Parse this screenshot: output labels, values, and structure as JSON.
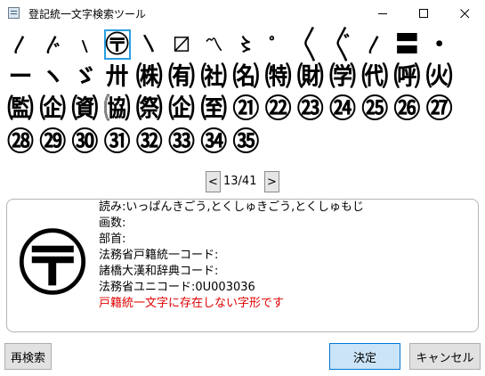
{
  "window": {
    "title": "登記統一文字検索ツール",
    "minimize_icon": "minimize-icon",
    "maximize_icon": "maximize-icon",
    "close_icon": "close-icon"
  },
  "glyph_grid": {
    "selected_color": "#2b9fe0",
    "rows": [
      [
        "〳",
        "〴",
        "﹨",
        "〶",
        "〵",
        "〼",
        "〽",
        "〻",
        "゜",
        "〱",
        "〲",
        "〳",
        "〓",
        "・"
      ],
      [
        "ー",
        "ヽ",
        "ゞ",
        "〺",
        "㈱",
        "㈲",
        "㈳",
        "㈴",
        "㈵",
        "㈶",
        "㈻",
        "㈹",
        "㈺",
        "㈫"
      ],
      [
        "㈼",
        "㈽",
        "㈾",
        "㈿",
        "㉀",
        "㈽",
        "㉃",
        "㉑",
        "㉒",
        "㉓",
        "㉔",
        "㉕",
        "㉖",
        "㉗"
      ],
      [
        "㉘",
        "㉙",
        "㉚",
        "㉛",
        "㉜",
        "㉝",
        "㉞",
        "㉟"
      ]
    ],
    "selected": "〶"
  },
  "pager": {
    "prev_label": "<",
    "page_text": "13/41",
    "next_label": ">"
  },
  "detail": {
    "big_glyph": "〶",
    "reading": "読み:いっぱんきごう,とくしゅきごう,とくしゅもじ",
    "strokes": "画数:",
    "radical": "部首:",
    "moj_koseki_code": "法務省戸籍統一コード:",
    "morohashi_code": "諸橋大漢和辞典コード:",
    "moj_unicode": "法務省ユニコード:0U003036",
    "warning": "戸籍統一文字に存在しない字形です",
    "warning_color": "#e00000"
  },
  "buttons": {
    "research": "再検索",
    "ok": "決定",
    "cancel": "キャンセル"
  }
}
